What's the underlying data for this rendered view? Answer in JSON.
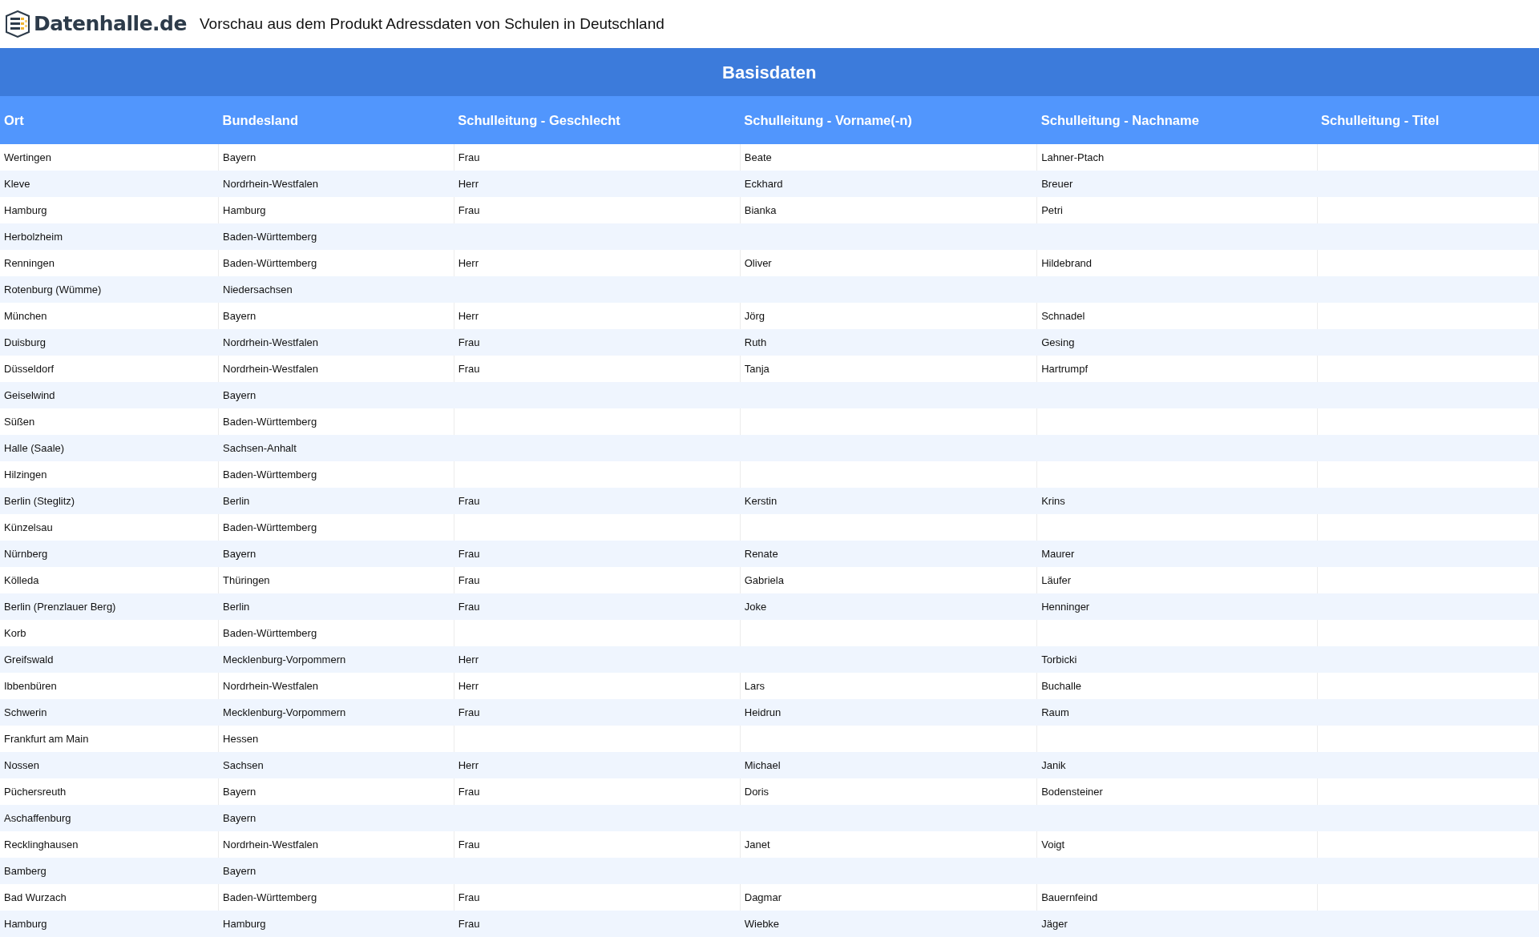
{
  "header": {
    "logo_text": "Datenhalle.de",
    "title": "Vorschau aus dem Produkt Adressdaten von Schulen in Deutschland"
  },
  "table": {
    "group_title": "Basisdaten",
    "columns": [
      "Ort",
      "Bundesland",
      "Schulleitung - Geschlecht",
      "Schulleitung - Vorname(-n)",
      "Schulleitung - Nachname",
      "Schulleitung - Titel"
    ],
    "rows": [
      [
        "Wertingen",
        "Bayern",
        "Frau",
        "Beate",
        "Lahner-Ptach"
      ],
      [
        "Kleve",
        "Nordrhein-Westfalen",
        "Herr",
        "Eckhard",
        "Breuer"
      ],
      [
        "Hamburg",
        "Hamburg",
        "Frau",
        "Bianka",
        "Petri"
      ],
      [
        "Herbolzheim",
        "Baden-Württemberg"
      ],
      [
        "Renningen",
        "Baden-Württemberg",
        "Herr",
        "Oliver",
        "Hildebrand"
      ],
      [
        "Rotenburg (Wümme)",
        "Niedersachsen"
      ],
      [
        "München",
        "Bayern",
        "Herr",
        "Jörg",
        "Schnadel"
      ],
      [
        "Duisburg",
        "Nordrhein-Westfalen",
        "Frau",
        "Ruth",
        "Gesing"
      ],
      [
        "Düsseldorf",
        "Nordrhein-Westfalen",
        "Frau",
        "Tanja",
        "Hartrumpf"
      ],
      [
        "Geiselwind",
        "Bayern"
      ],
      [
        "Süßen",
        "Baden-Württemberg"
      ],
      [
        "Halle (Saale)",
        "Sachsen-Anhalt"
      ],
      [
        "Hilzingen",
        "Baden-Württemberg"
      ],
      [
        "Berlin (Steglitz)",
        "Berlin",
        "Frau",
        "Kerstin",
        "Krins"
      ],
      [
        "Künzelsau",
        "Baden-Württemberg"
      ],
      [
        "Nürnberg",
        "Bayern",
        "Frau",
        "Renate",
        "Maurer"
      ],
      [
        "Kölleda",
        "Thüringen",
        "Frau",
        "Gabriela",
        "Läufer"
      ],
      [
        "Berlin (Prenzlauer Berg)",
        "Berlin",
        "Frau",
        "Joke",
        "Henninger"
      ],
      [
        "Korb",
        "Baden-Württemberg"
      ],
      [
        "Greifswald",
        "Mecklenburg-Vorpommern",
        "Herr",
        null,
        "Torbicki"
      ],
      [
        "Ibbenbüren",
        "Nordrhein-Westfalen",
        "Herr",
        "Lars",
        "Buchalle"
      ],
      [
        "Schwerin",
        "Mecklenburg-Vorpommern",
        "Frau",
        "Heidrun",
        "Raum"
      ],
      [
        "Frankfurt am Main",
        "Hessen"
      ],
      [
        "Nossen",
        "Sachsen",
        "Herr",
        "Michael",
        "Janik"
      ],
      [
        "Püchersreuth",
        "Bayern",
        "Frau",
        "Doris",
        "Bodensteiner"
      ],
      [
        "Aschaffenburg",
        "Bayern"
      ],
      [
        "Recklinghausen",
        "Nordrhein-Westfalen",
        "Frau",
        "Janet",
        "Voigt"
      ],
      [
        "Bamberg",
        "Bayern"
      ],
      [
        "Bad Wurzach",
        "Baden-Württemberg",
        "Frau",
        "Dagmar",
        "Bauernfeind"
      ],
      [
        "Hamburg",
        "Hamburg",
        "Frau",
        "Wiebke",
        "Jäger"
      ]
    ]
  }
}
